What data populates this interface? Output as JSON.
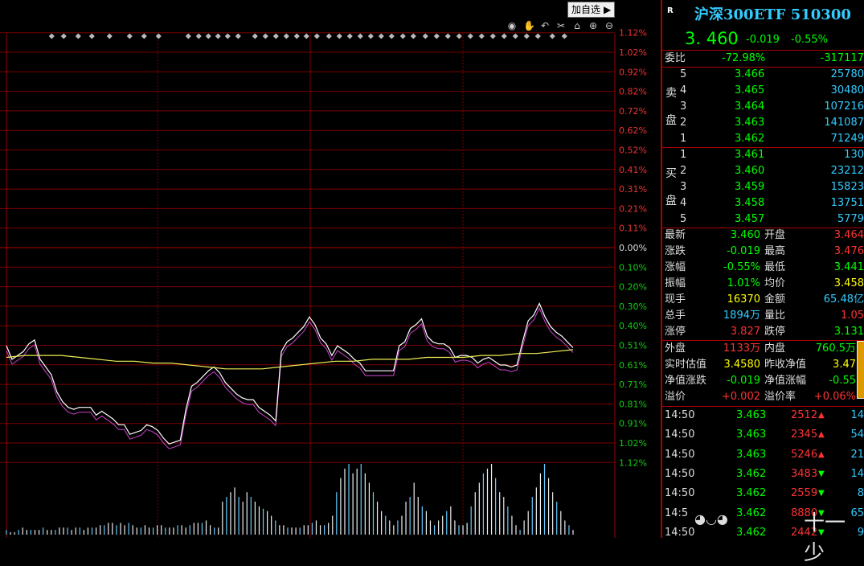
{
  "toolbar": {
    "add_watch_label": "加自选",
    "icons": [
      "eye-icon",
      "hand-icon",
      "undo-icon",
      "scissors-icon",
      "lock-icon",
      "zoom-in-icon",
      "zoom-out-icon"
    ]
  },
  "chart_data": {
    "type": "line",
    "percent_labels_top": [
      "1.12%",
      "1.02%",
      "0.92%",
      "0.82%",
      "0.72%",
      "0.62%",
      "0.52%",
      "0.41%",
      "0.31%",
      "0.21%",
      "0.11%"
    ],
    "zero_label": "0.00%",
    "percent_labels_bottom": [
      "0.10%",
      "0.20%",
      "0.30%",
      "0.40%",
      "0.51%",
      "0.61%",
      "0.71%",
      "0.81%",
      "0.91%",
      "1.02%",
      "1.12%"
    ],
    "price_line": [
      0.51,
      0.58,
      0.56,
      0.54,
      0.5,
      0.48,
      0.58,
      0.62,
      0.66,
      0.75,
      0.8,
      0.83,
      0.84,
      0.83,
      0.83,
      0.83,
      0.87,
      0.85,
      0.87,
      0.89,
      0.92,
      0.92,
      0.97,
      0.96,
      0.95,
      0.92,
      0.93,
      0.95,
      0.99,
      1.02,
      1.01,
      1.0,
      0.84,
      0.72,
      0.7,
      0.67,
      0.64,
      0.62,
      0.65,
      0.7,
      0.73,
      0.76,
      0.78,
      0.79,
      0.79,
      0.83,
      0.85,
      0.87,
      0.9,
      0.54,
      0.49,
      0.47,
      0.44,
      0.41,
      0.36,
      0.4,
      0.47,
      0.5,
      0.56,
      0.51,
      0.53,
      0.55,
      0.58,
      0.6,
      0.64,
      0.64,
      0.64,
      0.64,
      0.64,
      0.64,
      0.51,
      0.49,
      0.42,
      0.4,
      0.37,
      0.46,
      0.49,
      0.5,
      0.5,
      0.52,
      0.57,
      0.56,
      0.56,
      0.57,
      0.6,
      0.58,
      0.57,
      0.59,
      0.61,
      0.61,
      0.62,
      0.61,
      0.49,
      0.38,
      0.35,
      0.29,
      0.36,
      0.41,
      0.44,
      0.46,
      0.49,
      0.52
    ],
    "avg_line": [
      0.57,
      0.56,
      0.56,
      0.56,
      0.57,
      0.58,
      0.59,
      0.59,
      0.6,
      0.6,
      0.61,
      0.62,
      0.63,
      0.63,
      0.63,
      0.62,
      0.61,
      0.6,
      0.59,
      0.59,
      0.58,
      0.58,
      0.58,
      0.57,
      0.57,
      0.57,
      0.56,
      0.56,
      0.55,
      0.55,
      0.54,
      0.53
    ],
    "volume": [
      2,
      1,
      1,
      2,
      3,
      2,
      2,
      2,
      2,
      3,
      2,
      2,
      2,
      3,
      3,
      3,
      2,
      3,
      3,
      2,
      3,
      3,
      3,
      4,
      4,
      5,
      5,
      4,
      5,
      4,
      5,
      4,
      3,
      3,
      4,
      3,
      3,
      4,
      4,
      3,
      3,
      3,
      4,
      4,
      3,
      4,
      5,
      5,
      5,
      6,
      4,
      3,
      3,
      14,
      16,
      18,
      20,
      16,
      14,
      18,
      16,
      14,
      12,
      11,
      10,
      8,
      6,
      4,
      4,
      3,
      3,
      3,
      3,
      4,
      4,
      5,
      6,
      4,
      4,
      5,
      8,
      18,
      24,
      28,
      30,
      26,
      28,
      30,
      26,
      22,
      18,
      14,
      10,
      8,
      6,
      4,
      6,
      8,
      14,
      16,
      22,
      16,
      12,
      10,
      6,
      4,
      6,
      8,
      10,
      12,
      6,
      4,
      4,
      5,
      12,
      18,
      22,
      26,
      28,
      30,
      24,
      18,
      16,
      12,
      8,
      4,
      2,
      6,
      10,
      16,
      20,
      26,
      30,
      24,
      18,
      14,
      10,
      6,
      4,
      2
    ]
  },
  "panel": {
    "r_mark": "R",
    "title": "沪深300ETF 510300",
    "price": "3. 460",
    "change": "-0.019",
    "change_pct": "-0.55%",
    "weibi_label": "委比",
    "weibi_pct": "-72.98%",
    "weibi_diff": "-317117",
    "sell_label_1": "卖",
    "sell_label_2": "盘",
    "buy_label_1": "买",
    "buy_label_2": "盘",
    "sell": [
      {
        "level": "5",
        "price": "3.466",
        "vol": "25780"
      },
      {
        "level": "4",
        "price": "3.465",
        "vol": "30480"
      },
      {
        "level": "3",
        "price": "3.464",
        "vol": "107216"
      },
      {
        "level": "2",
        "price": "3.463",
        "vol": "141087"
      },
      {
        "level": "1",
        "price": "3.462",
        "vol": "71249"
      }
    ],
    "buy": [
      {
        "level": "1",
        "price": "3.461",
        "vol": "130"
      },
      {
        "level": "2",
        "price": "3.460",
        "vol": "23212"
      },
      {
        "level": "3",
        "price": "3.459",
        "vol": "15823"
      },
      {
        "level": "4",
        "price": "3.458",
        "vol": "13751"
      },
      {
        "level": "5",
        "price": "3.457",
        "vol": "5779"
      }
    ],
    "stats": [
      {
        "l1": "最新",
        "v1": "3.460",
        "l2": "开盘",
        "v2": "3.464"
      },
      {
        "l1": "涨跌",
        "v1": "-0.019",
        "l2": "最高",
        "v2": "3.476"
      },
      {
        "l1": "涨幅",
        "v1": "-0.55%",
        "l2": "最低",
        "v2": "3.441"
      },
      {
        "l1": "振幅",
        "v1": "1.01%",
        "l2": "均价",
        "v2": "3.458"
      },
      {
        "l1": "现手",
        "v1": "16370",
        "l2": "金额",
        "v2": "65.48亿"
      },
      {
        "l1": "总手",
        "v1": "1894万",
        "l2": "量比",
        "v2": "1.05"
      },
      {
        "l1": "涨停",
        "v1": "3.827",
        "l2": "跌停",
        "v2": "3.131"
      }
    ],
    "stats2": [
      {
        "l1": "外盘",
        "v1": "1133万",
        "l2": "内盘",
        "v2": "760.5万"
      },
      {
        "l1": "实时估值",
        "v1": "3.4580",
        "l2": "昨收净值",
        "v2": "3.47"
      },
      {
        "l1": "净值涨跌",
        "v1": "-0.019",
        "l2": "净值涨幅",
        "v2": "-0.55"
      },
      {
        "l1": "溢价",
        "v1": "+0.002",
        "l2": "溢价率",
        "v2": "+0.06%"
      }
    ],
    "ticks": [
      {
        "time": "14:50",
        "price": "3.463",
        "vol": "2512",
        "n": "14",
        "arrow": "up"
      },
      {
        "time": "14:50",
        "price": "3.463",
        "vol": "2345",
        "n": "54",
        "arrow": "up"
      },
      {
        "time": "14:50",
        "price": "3.463",
        "vol": "5246",
        "n": "21",
        "arrow": "up"
      },
      {
        "time": "14:50",
        "price": "3.462",
        "vol": "3483",
        "n": "14",
        "arrow": "down"
      },
      {
        "time": "14:50",
        "price": "3.462",
        "vol": "2559",
        "n": "8",
        "arrow": "down"
      },
      {
        "time": "14:5",
        "price": "3.462",
        "vol": "8880",
        "n": "65",
        "arrow": "down"
      },
      {
        "time": "14:50",
        "price": "3.462",
        "vol": "2442",
        "n": "9",
        "arrow": "down"
      }
    ],
    "watermark": "十一少"
  }
}
